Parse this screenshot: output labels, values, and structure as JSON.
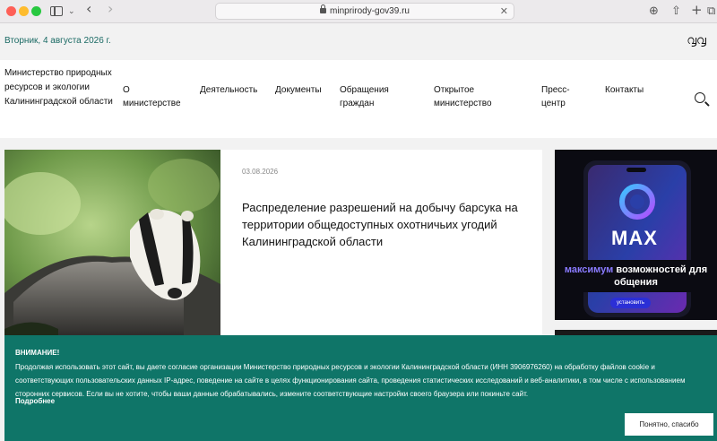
{
  "browser": {
    "url": "minprirody-gov39.ru"
  },
  "topbar": {
    "date": "Вторник, 4 августа 2026 г."
  },
  "header": {
    "org_name": "Министерство природных ресурсов и экологии Калининградской области",
    "nav": [
      {
        "label": "О министерстве"
      },
      {
        "label": "Деятельность"
      },
      {
        "label": "Документы"
      },
      {
        "label": "Обращения граждан"
      },
      {
        "label": "Открытое министерство"
      },
      {
        "label": "Пресс-центр"
      },
      {
        "label": "Контакты"
      }
    ]
  },
  "news": {
    "date": "03.08.2026",
    "title": "Распределение разрешений на добычу барсука на территории общедоступных охотничьих угодий Калининградской области"
  },
  "banner": {
    "app_name": "MAX",
    "headline_accent": "максимум",
    "headline_rest": "возможностей для общения",
    "button_label": "установить"
  },
  "cookie": {
    "title": "ВНИМАНИЕ!",
    "text": "Продолжая использовать этот сайт, вы даете согласие организации Министерство природных ресурсов и экологии Калининградской области (ИНН 3906976260) на обработку файлов cookie и соответствующих пользовательских данных IP-адрес, поведение на сайте в целях функционирования сайта, проведения статистических исследований и веб-аналитики, в том числе с использованием сторонних сервисов. Если вы не хотите, чтобы ваши данные обрабатывались, измените соответствующие настройки своего браузера или покиньте сайт.",
    "more_label": "Подробнее",
    "accept_label": "Понятно, спасибо"
  },
  "colors": {
    "accent_teal": "#0f7568",
    "date_text": "#1a6a64"
  }
}
